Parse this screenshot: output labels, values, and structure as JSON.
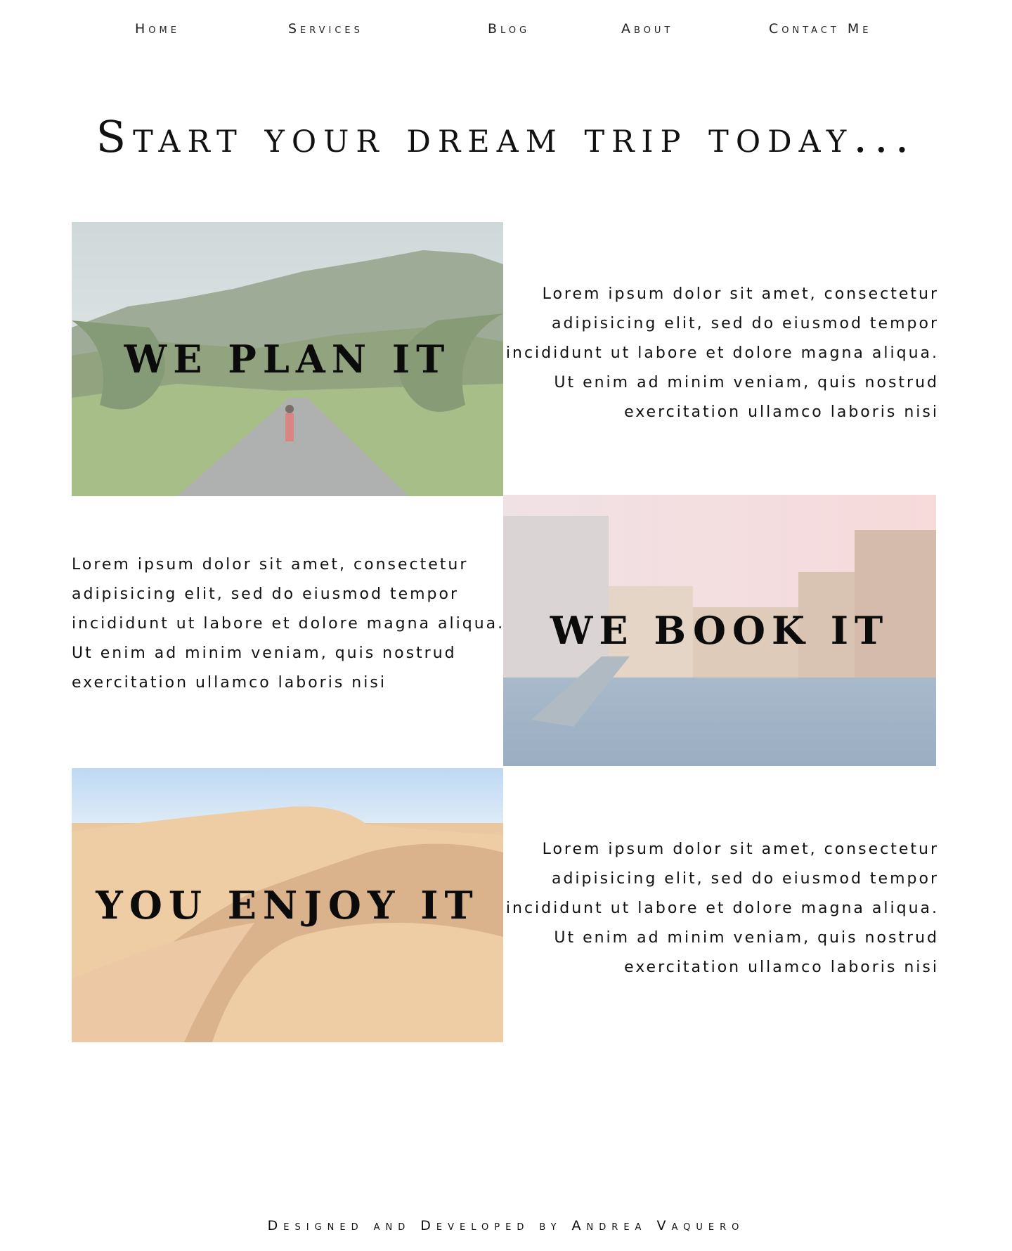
{
  "nav": {
    "items": [
      {
        "label": "Home"
      },
      {
        "label": "Services"
      },
      {
        "label": "Blog"
      },
      {
        "label": "About"
      },
      {
        "label": "Contact Me"
      }
    ]
  },
  "hero": {
    "title": "Start your dream trip today..."
  },
  "sections": [
    {
      "label": "WE PLAN IT",
      "text": "Lorem ipsum dolor sit amet, consectetur adipisicing elit, sed do eiusmod tempor incididunt ut labore et dolore magna aliqua. Ut enim ad minim veniam, quis nostrud exercitation ullamco laboris nisi"
    },
    {
      "label": "WE BOOK IT",
      "text": "Lorem ipsum dolor sit amet, consectetur adipisicing elit, sed do eiusmod tempor incididunt ut labore et dolore magna aliqua. Ut enim ad minim veniam, quis nostrud exercitation ullamco laboris nisi"
    },
    {
      "label": "YOU ENJOY IT",
      "text": "Lorem ipsum dolor sit amet, consectetur adipisicing elit, sed do eiusmod tempor incididunt ut labore et dolore magna aliqua. Ut enim ad minim veniam, quis nostrud exercitation ullamco laboris nisi"
    }
  ],
  "footer": {
    "text": "Designed and Developed by Andrea Vaquero"
  }
}
